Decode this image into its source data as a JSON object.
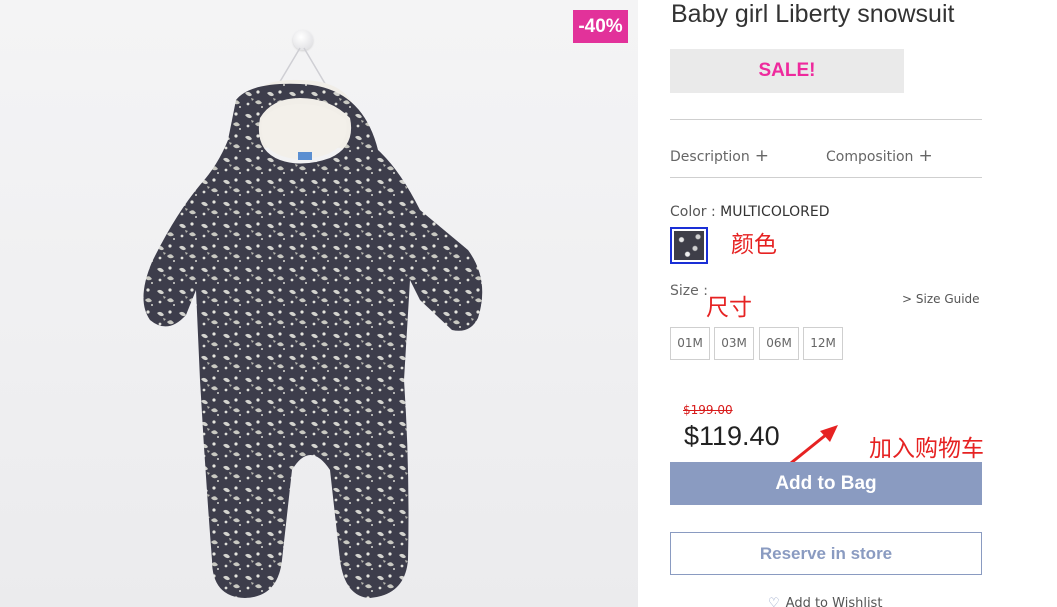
{
  "product": {
    "title": "Baby girl Liberty snowsuit",
    "discount_badge": "-40%",
    "sale_label": "SALE!",
    "image_icon": "snowsuit-photo"
  },
  "tabs": {
    "description": "Description",
    "composition": "Composition",
    "plus_symbol": "+"
  },
  "color": {
    "label": "Color :",
    "value": "MULTICOLORED"
  },
  "size": {
    "label": "Size :",
    "guide": "> Size Guide",
    "options": [
      "01M",
      "03M",
      "06M",
      "12M"
    ]
  },
  "price": {
    "original": "$199.00",
    "current": "$119.40"
  },
  "actions": {
    "add_to_bag": "Add to Bag",
    "reserve": "Reserve in store",
    "wishlist": "Add to Wishlist"
  },
  "annotations": {
    "color": "颜色",
    "size": "尺寸",
    "cart": "加入购物车"
  },
  "colors": {
    "badge": "#e2329a",
    "sale_text": "#ee2a9d",
    "button": "#8a9bc1",
    "swatch_border": "#1a2fd6",
    "annotation": "#e62222",
    "old_price": "#d81b1b"
  }
}
